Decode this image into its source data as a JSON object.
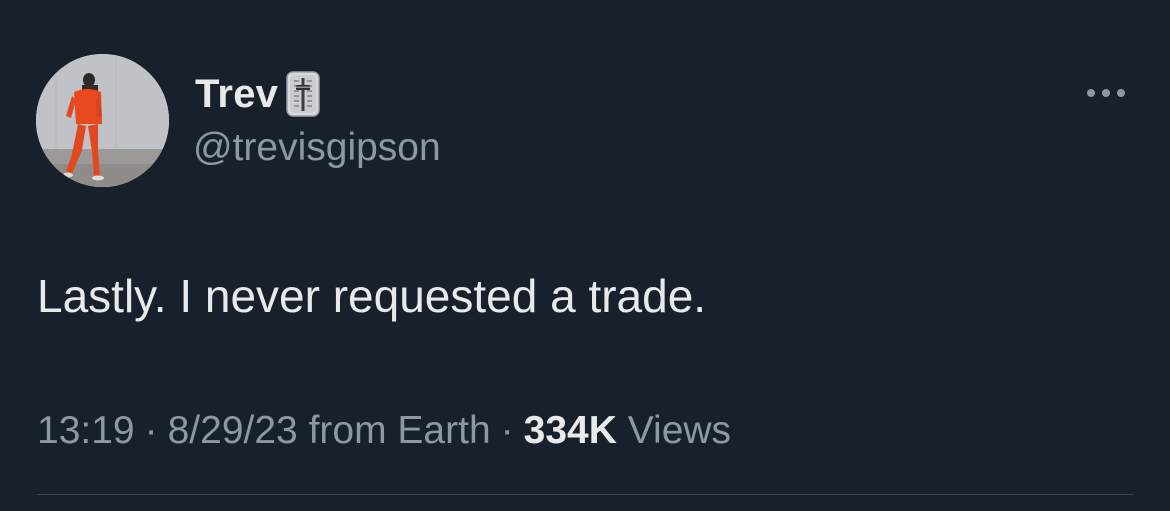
{
  "author": {
    "display_name": "Trev",
    "badge_icon": "level-slider-icon",
    "handle": "@trevisgipson"
  },
  "tweet": {
    "text": "Lastly. I never requested a trade."
  },
  "meta": {
    "time": "13:19",
    "date": "8/29/23",
    "source": "from Earth",
    "separator": "·",
    "views_count": "334K",
    "views_label": "Views"
  },
  "icons": {
    "more": "more-horizontal-icon"
  },
  "colors": {
    "background": "#18202b",
    "primary_text": "#e7e9ea",
    "secondary_text": "#8b98a5",
    "divider": "#38444d"
  }
}
